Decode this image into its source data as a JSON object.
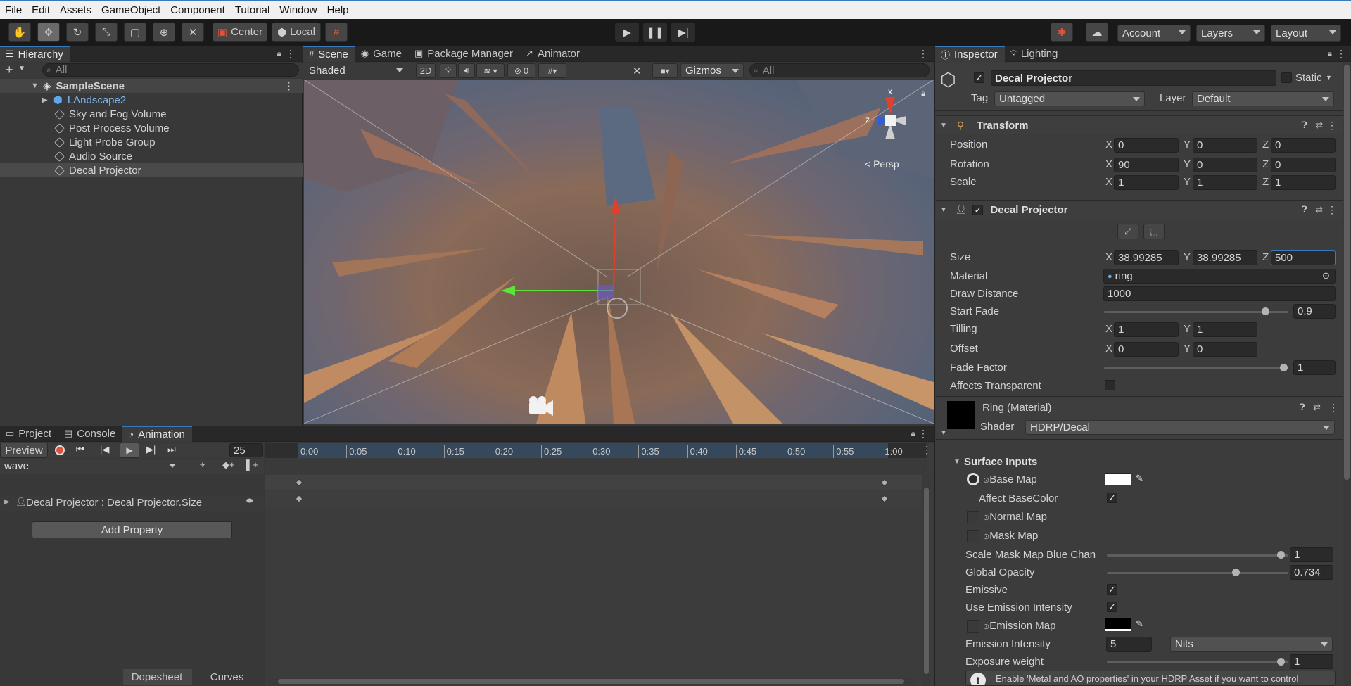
{
  "menubar": [
    "File",
    "Edit",
    "Assets",
    "GameObject",
    "Component",
    "Tutorial",
    "Window",
    "Help"
  ],
  "toolbar": {
    "pivot": "Center",
    "space": "Local",
    "account": "Account",
    "layers": "Layers",
    "layout": "Layout"
  },
  "hierarchy": {
    "title": "Hierarchy",
    "search_placeholder": "All",
    "scene": "SampleScene",
    "items": [
      "LAndscape2",
      "Sky and Fog Volume",
      "Post Process Volume",
      "Light Probe Group",
      "Audio Source",
      "Decal Projector"
    ]
  },
  "scene_tabs": [
    "Scene",
    "Game",
    "Package Manager",
    "Animator"
  ],
  "scene_toolbar": {
    "shading": "Shaded",
    "mode2d": "2D",
    "hidden_count": "0",
    "gizmos": "Gizmos",
    "search_placeholder": "All",
    "persp": "< Persp",
    "axis_x": "x",
    "axis_z": "z"
  },
  "bottom_tabs": [
    "Project",
    "Console",
    "Animation"
  ],
  "animation": {
    "preview": "Preview",
    "frame": "25",
    "clip": "wave",
    "property": "Decal Projector : Decal Projector.Size",
    "add_property": "Add Property",
    "timeline_labels": [
      "0:00",
      "0:05",
      "0:10",
      "0:15",
      "0:20",
      "0:25",
      "0:30",
      "0:35",
      "0:40",
      "0:45",
      "0:50",
      "0:55",
      "1:00"
    ],
    "dopesheet": "Dopesheet",
    "curves": "Curves"
  },
  "inspector": {
    "tabs": [
      "Inspector",
      "Lighting"
    ],
    "object_name": "Decal Projector",
    "static": "Static",
    "tag_label": "Tag",
    "tag": "Untagged",
    "layer_label": "Layer",
    "layer": "Default",
    "transform": {
      "title": "Transform",
      "position_label": "Position",
      "rotation_label": "Rotation",
      "scale_label": "Scale",
      "position": [
        "0",
        "0",
        "0"
      ],
      "rotation": [
        "90",
        "0",
        "0"
      ],
      "scale": [
        "1",
        "1",
        "1"
      ]
    },
    "decal": {
      "title": "Decal Projector",
      "size_label": "Size",
      "size": [
        "38.99285",
        "38.99285",
        "500"
      ],
      "material_label": "Material",
      "material": "ring",
      "draw_distance_label": "Draw Distance",
      "draw_distance": "1000",
      "start_fade_label": "Start Fade",
      "start_fade": "0.9",
      "tilling_label": "Tilling",
      "tilling": [
        "1",
        "1"
      ],
      "offset_label": "Offset",
      "offset": [
        "0",
        "0"
      ],
      "fade_factor_label": "Fade Factor",
      "fade_factor": "1",
      "affects_transparent_label": "Affects Transparent"
    },
    "material": {
      "title": "Ring (Material)",
      "shader_label": "Shader",
      "shader": "HDRP/Decal",
      "surface_inputs": "Surface Inputs",
      "base_map": "Base Map",
      "affect_basecolor": "Affect BaseColor",
      "normal_map": "Normal Map",
      "mask_map": "Mask Map",
      "scale_mask_label": "Scale Mask Map Blue Chan",
      "scale_mask": "1",
      "global_opacity_label": "Global Opacity",
      "global_opacity": "0.734",
      "emissive": "Emissive",
      "use_emission_intensity": "Use Emission Intensity",
      "emission_map": "Emission Map",
      "emission_intensity_label": "Emission Intensity",
      "emission_intensity": "5",
      "emission_unit": "Nits",
      "exposure_weight_label": "Exposure weight",
      "exposure_weight": "1",
      "warning": "Enable 'Metal and AO properties' in your HDRP Asset if you want to control"
    }
  },
  "axis": {
    "x": "X",
    "y": "Y",
    "z": "Z"
  },
  "colors": {
    "accent": "#3a79bb",
    "record": "#e0513a",
    "panel": "#383838",
    "header": "#282828"
  }
}
